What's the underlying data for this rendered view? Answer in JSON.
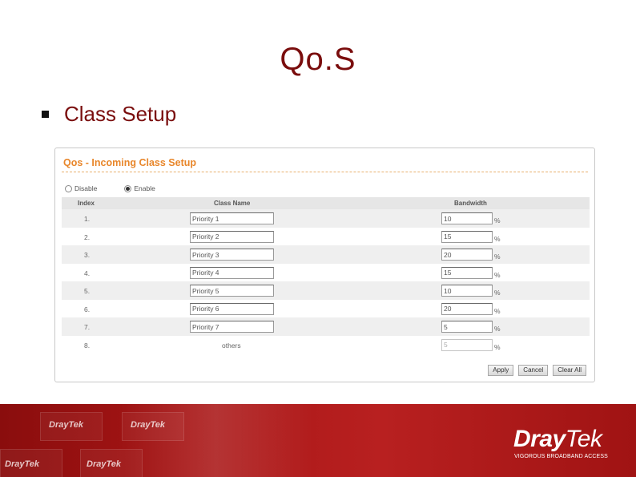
{
  "slide": {
    "title": "Qo.S",
    "bullet": "Class Setup"
  },
  "panel": {
    "title": "Qos - Incoming Class Setup",
    "modes": [
      {
        "label": "Disable",
        "selected": false
      },
      {
        "label": "Enable",
        "selected": true
      }
    ],
    "columns": {
      "index": "Index",
      "class_name": "Class Name",
      "bandwidth": "Bandwidth"
    },
    "rows": [
      {
        "index": "1.",
        "name": "Priority 1",
        "bandwidth": "10",
        "unit": "%"
      },
      {
        "index": "2.",
        "name": "Priority 2",
        "bandwidth": "15",
        "unit": "%"
      },
      {
        "index": "3.",
        "name": "Priority 3",
        "bandwidth": "20",
        "unit": "%"
      },
      {
        "index": "4.",
        "name": "Priority 4",
        "bandwidth": "15",
        "unit": "%"
      },
      {
        "index": "5.",
        "name": "Priority 5",
        "bandwidth": "10",
        "unit": "%"
      },
      {
        "index": "6.",
        "name": "Priority 6",
        "bandwidth": "20",
        "unit": "%"
      },
      {
        "index": "7.",
        "name": "Priority 7",
        "bandwidth": "5",
        "unit": "%"
      },
      {
        "index": "8.",
        "name": "others",
        "bandwidth": "5",
        "unit": "%"
      }
    ],
    "buttons": {
      "apply": "Apply",
      "cancel": "Cancel",
      "clear_all": "Clear All"
    }
  },
  "footer": {
    "watermark": "DrayTek",
    "logo_bold": "Dray",
    "logo_light": "Tek",
    "tagline": "VIGOROUS BROADBAND ACCESS"
  },
  "colors": {
    "title": "#7a0d0d",
    "panel_title": "#e8862a",
    "footer": "#a81616"
  }
}
